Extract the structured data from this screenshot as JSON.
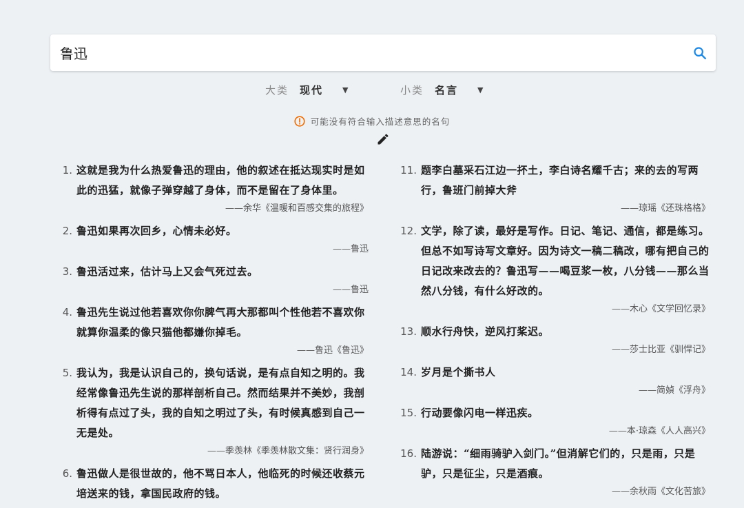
{
  "search": {
    "query": "鲁迅"
  },
  "filters": {
    "category": {
      "label": "大类",
      "value": "现代"
    },
    "subcategory": {
      "label": "小类",
      "value": "名言"
    }
  },
  "warning": "可能没有符合输入描述意思的名句",
  "left_quotes": [
    {
      "num": "1.",
      "text": "这就是我为什么热爱鲁迅的理由，他的叙述在抵达现实时是如此的迅猛，就像子弹穿越了身体，而不是留在了身体里。",
      "source": "——余华《温暖和百感交集的旅程》"
    },
    {
      "num": "2.",
      "text": "鲁迅如果再次回乡，心情未必好。",
      "source": "——鲁迅"
    },
    {
      "num": "3.",
      "text": "鲁迅活过来，估计马上又会气死过去。",
      "source": "——鲁迅"
    },
    {
      "num": "4.",
      "text": "鲁迅先生说过他若喜欢你你脾气再大那都叫个性他若不喜欢你就算你温柔的像只猫他都嫌你掉毛。",
      "source": "——鲁迅《鲁迅》"
    },
    {
      "num": "5.",
      "text": "我认为，我是认识自己的，换句话说，是有点自知之明的。我经常像鲁迅先生说的那样剖析自己。然而结果并不美妙，我剖析得有点过了头，我的自知之明过了头，有时候真感到自己一无是处。",
      "source": "——季羡林《季羡林散文集：贤行润身》"
    },
    {
      "num": "6.",
      "text": "鲁迅做人是很世故的，他不骂日本人，他临死的时候还收蔡元培送来的钱，拿国民政府的钱。",
      "source": ""
    }
  ],
  "right_quotes": [
    {
      "num": "11.",
      "text": "题李白墓采石江边一抔土，李白诗名耀千古；来的去的写两行，鲁班门前掉大斧",
      "source": "——琼瑶《还珠格格》"
    },
    {
      "num": "12.",
      "text": "文学，除了读，最好是写作。日记、笔记、通信，都是练习。但总不如写诗写文章好。因为诗文一稿二稿改，哪有把自己的日记改来改去的？鲁迅写——喝豆浆一枚，八分钱——那么当然八分钱，有什么好改的。",
      "source": "——木心《文学回忆录》"
    },
    {
      "num": "13.",
      "text": "顺水行舟快，逆风打桨迟。",
      "source": "——莎士比亚《驯悍记》"
    },
    {
      "num": "14.",
      "text": "岁月是个撕书人",
      "source": "——简媜《浮舟》"
    },
    {
      "num": "15.",
      "text": "行动要像闪电一样迅疾。",
      "source": "——本·琼森《人人高兴》"
    },
    {
      "num": "16.",
      "text": "陆游说：“细雨骑驴入剑门。”但消解它们的，只是雨，只是驴，只是征尘，只是酒痕。",
      "source": "——余秋雨《文化苦旅》"
    }
  ],
  "colors": {
    "accent": "#1e88e5",
    "warning": "#ef6c00",
    "background": "#edf1f4"
  }
}
